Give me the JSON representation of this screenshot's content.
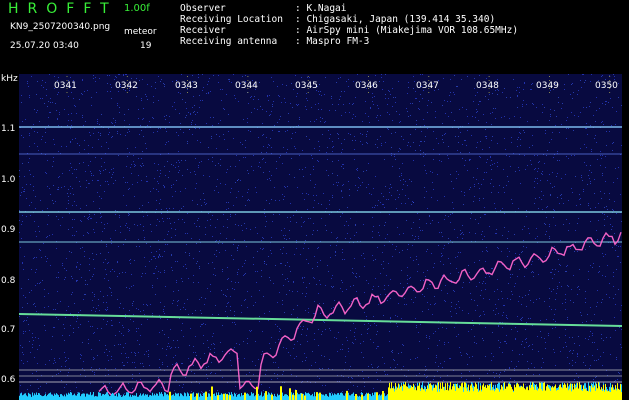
{
  "header": {
    "app_title": "HROFFT",
    "version": "1.00f",
    "filename": "KN9_2507200340.png",
    "datetime": "25.07.20 03:40",
    "meteor_label": "meteor",
    "meteor_count": "19"
  },
  "info": [
    {
      "key": "Observer",
      "value": ": K.Nagai"
    },
    {
      "key": "Receiving Location",
      "value": ": Chigasaki, Japan (139.414 35.340)"
    },
    {
      "key": "Receiver",
      "value": ": AirSpy mini (Miakejima VOR 108.65MHz)"
    },
    {
      "key": "Receiving antenna",
      "value": ": Maspro FM-3"
    }
  ],
  "spectrogram": {
    "y_unit": "kHz",
    "y_ticks": [
      "1.1",
      "1.0",
      "0.9",
      "0.8",
      "0.7",
      "0.6"
    ],
    "x_ticks": [
      "0341",
      "0342",
      "0343",
      "0344",
      "0345",
      "0346",
      "0347",
      "0348",
      "0349",
      "0350"
    ],
    "colors": {
      "background": "#080a40",
      "carrier": "#66dd99",
      "trace": "#ff66cc",
      "baseline_low": "#22ccff",
      "baseline_high": "#ffff00"
    }
  }
}
